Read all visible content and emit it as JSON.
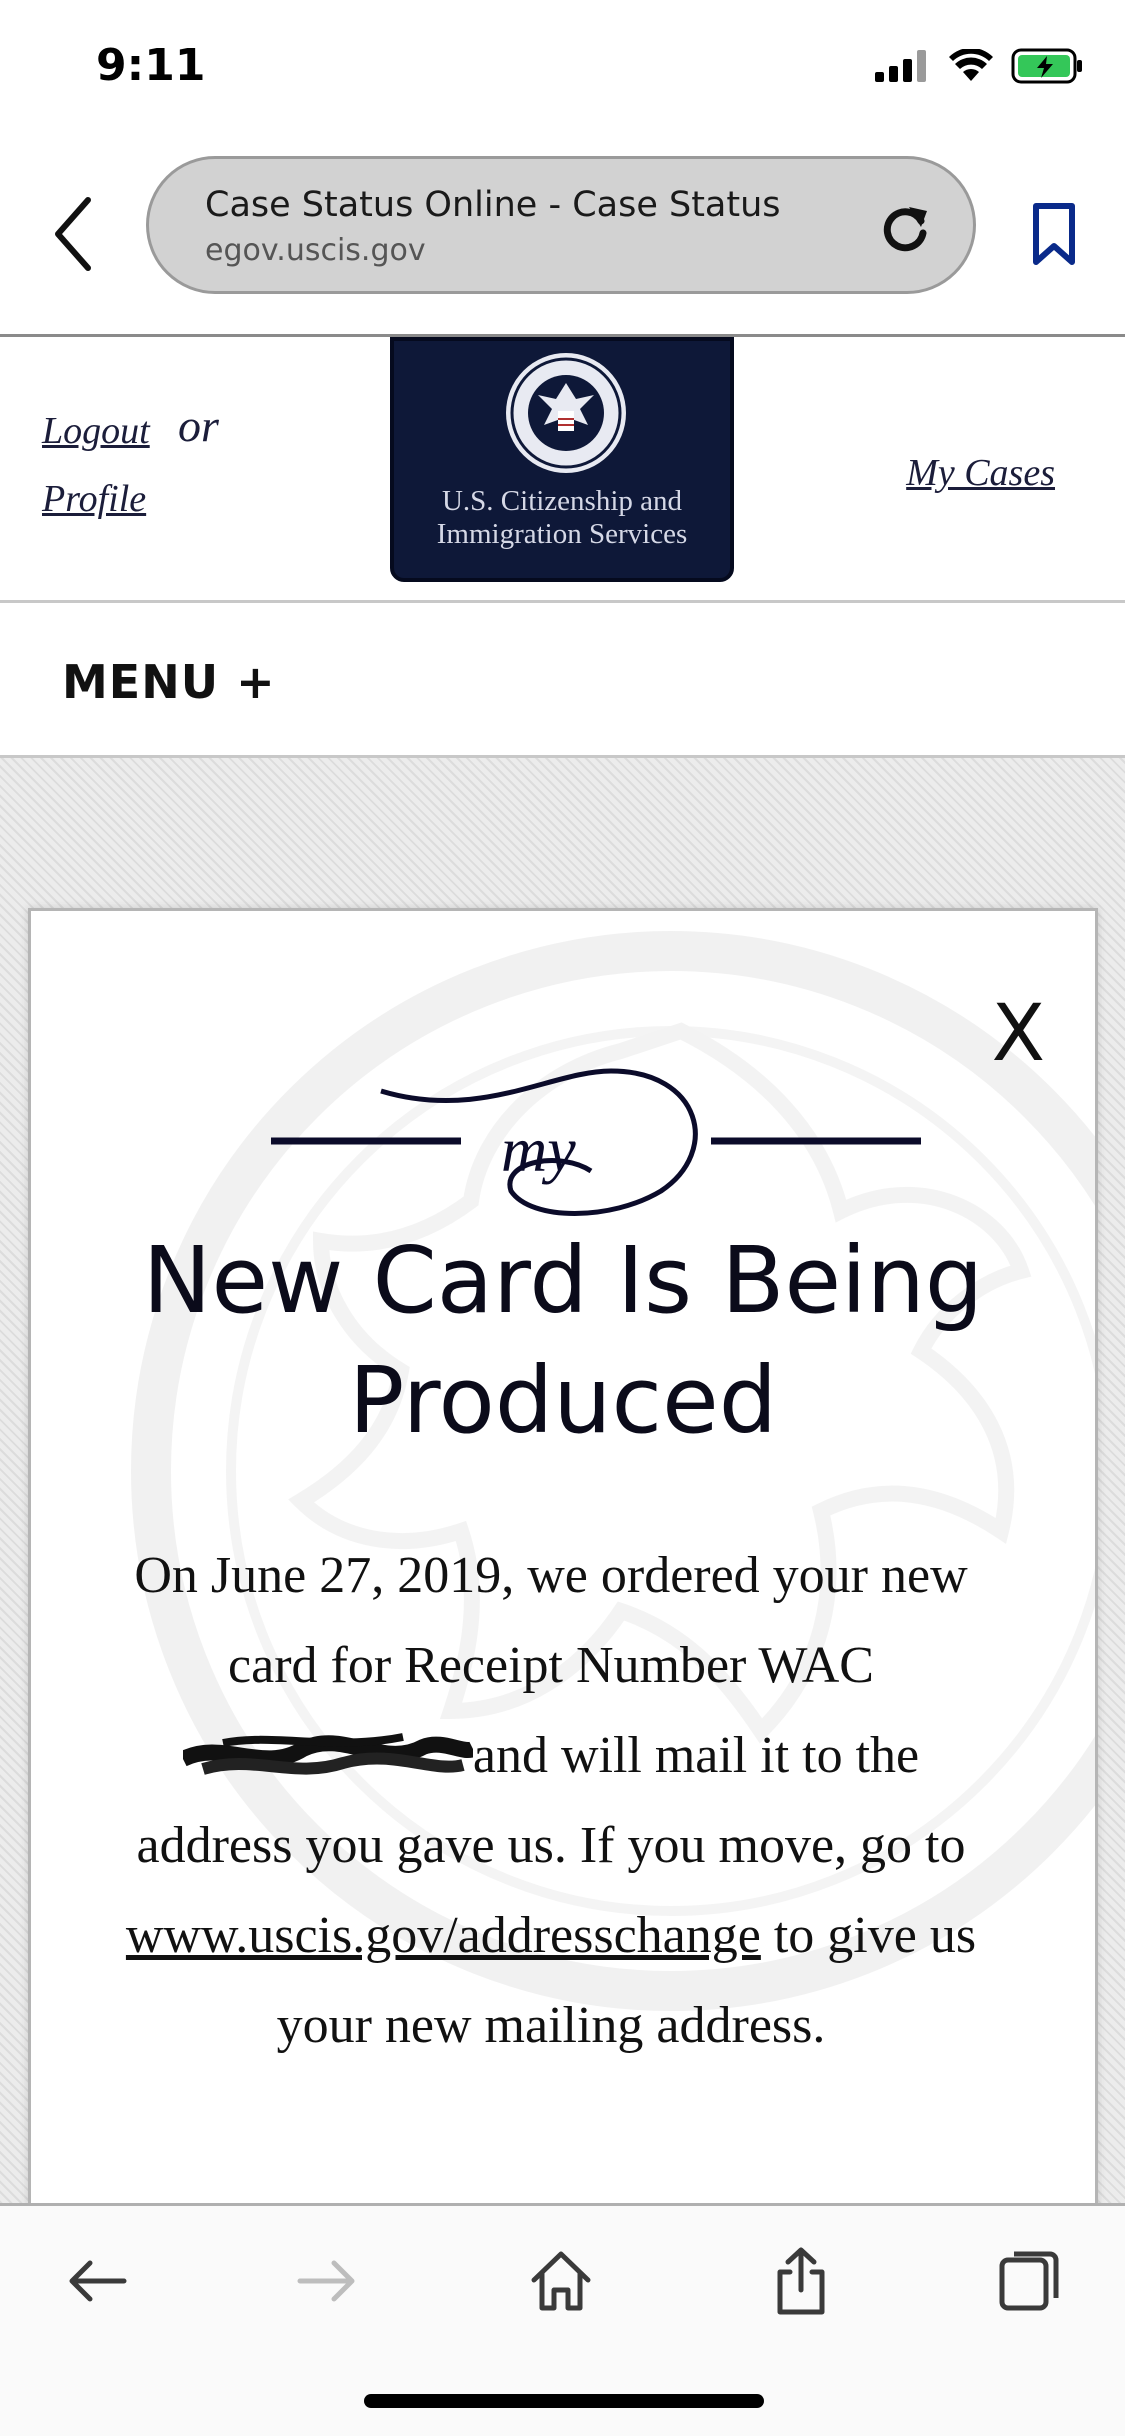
{
  "status": {
    "time": "9:11"
  },
  "browser": {
    "page_title": "Case Status Online - Case Status",
    "domain": "egov.uscis.gov"
  },
  "header": {
    "logout_label": "Logout",
    "or_text": "or",
    "profile_label": "Profile",
    "my_cases_label": "My Cases",
    "logo_line1": "U.S. Citizenship and",
    "logo_line2": "Immigration Services"
  },
  "menu": {
    "label": "MENU +"
  },
  "card": {
    "close_label": "X",
    "flourish_text": "my",
    "heading_line1": "New Card Is Being",
    "heading_line2": "Produced",
    "body_part1": "On June 27, 2019, we ordered your new card for Receipt Number WAC",
    "body_part2": "and will mail it to the address you gave us. If you move, go to",
    "link_text": "www.uscis.gov/addresschange",
    "body_part3": "to give us your new mailing address."
  },
  "colors": {
    "logo_bg": "#0e1838",
    "link_color": "#1b1d3a",
    "toolbar_active": "#3a3a3a",
    "toolbar_disabled": "#bdbdbd"
  },
  "icons": [
    "signal-icon",
    "wifi-icon",
    "battery-icon",
    "back-chevron-icon",
    "reload-icon",
    "bookmark-icon",
    "back-arrow-icon",
    "forward-arrow-icon",
    "home-icon",
    "share-icon",
    "tabs-icon"
  ]
}
